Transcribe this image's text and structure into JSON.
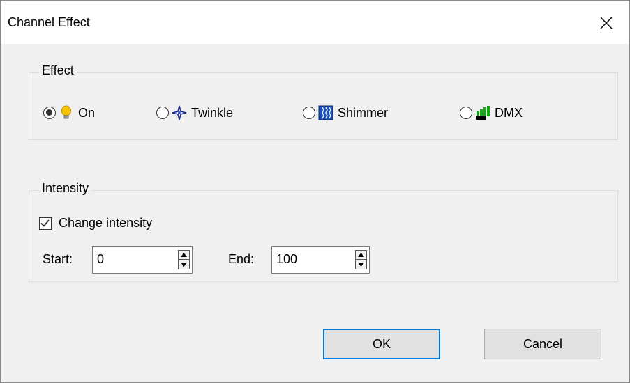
{
  "window": {
    "title": "Channel Effect"
  },
  "effect_group": {
    "label": "Effect",
    "options": [
      {
        "label": "On",
        "icon": "lightbulb-icon",
        "checked": true
      },
      {
        "label": "Twinkle",
        "icon": "sparkle-icon",
        "checked": false
      },
      {
        "label": "Shimmer",
        "icon": "shimmer-icon",
        "checked": false
      },
      {
        "label": "DMX",
        "icon": "dmx-icon",
        "checked": false
      }
    ]
  },
  "intensity_group": {
    "label": "Intensity",
    "change_intensity": {
      "label": "Change intensity",
      "checked": true
    },
    "start": {
      "label": "Start:",
      "value": "0"
    },
    "end": {
      "label": "End:",
      "value": "100"
    }
  },
  "buttons": {
    "ok": "OK",
    "cancel": "Cancel"
  },
  "colors": {
    "accent": "#0078d7",
    "dialog_bg": "#f0f0f0"
  }
}
